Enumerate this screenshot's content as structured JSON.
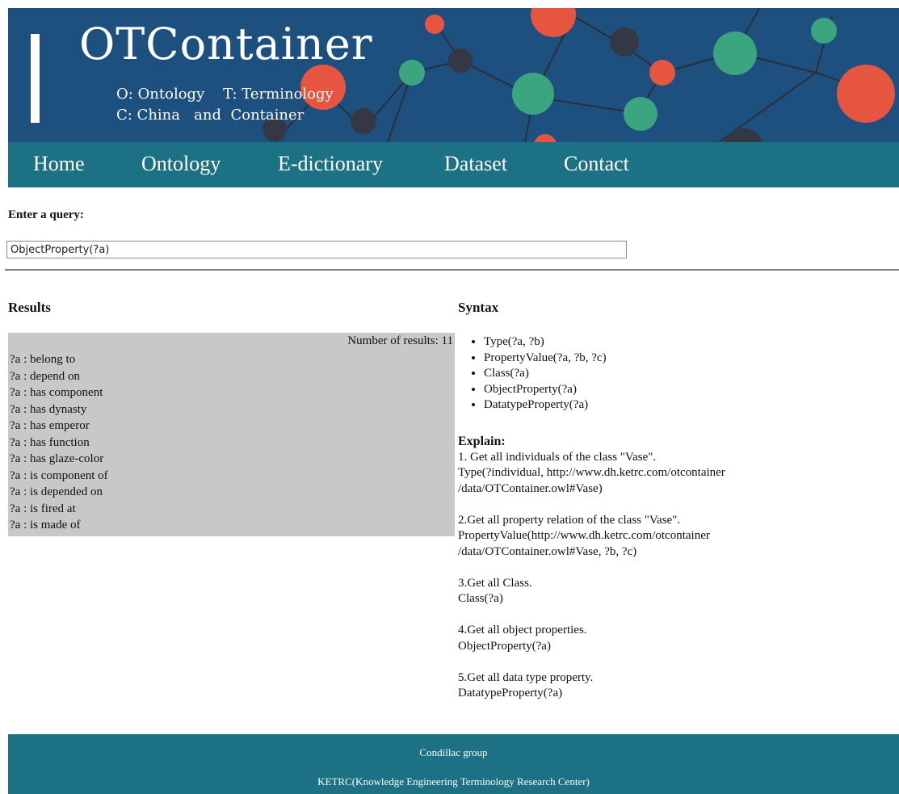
{
  "header": {
    "brand": "OTContainer",
    "tagline_1": "O: Ontology    T: Terminology",
    "tagline_2": "C: China   and  Container"
  },
  "nav": {
    "items": [
      {
        "label": "Home"
      },
      {
        "label": "Ontology"
      },
      {
        "label": "E-dictionary"
      },
      {
        "label": "Dataset"
      },
      {
        "label": "Contact"
      }
    ]
  },
  "query": {
    "label": "Enter a query:",
    "value": "ObjectProperty(?a)"
  },
  "results": {
    "title": "Results",
    "count_label": "Number of results:",
    "count": "11",
    "items": [
      "?a : belong to",
      "?a : depend on",
      "?a : has component",
      "?a : has dynasty",
      "?a : has emperor",
      "?a : has function",
      "?a : has glaze-color",
      "?a : is component of",
      "?a : is depended on",
      "?a : is fired at",
      "?a : is made of"
    ]
  },
  "syntax": {
    "title": "Syntax",
    "items": [
      "Type(?a, ?b)",
      "PropertyValue(?a, ?b, ?c)",
      "Class(?a)",
      "ObjectProperty(?a)",
      "DatatypeProperty(?a)"
    ]
  },
  "explain": {
    "title": "Explain:",
    "blocks": [
      {
        "lines": [
          "1. Get all individuals of the class \"Vase\".",
          "Type(?individual, http://www.dh.ketrc.com/otcontainer",
          "/data/OTContainer.owl#Vase)"
        ]
      },
      {
        "lines": [
          "2.Get all property relation of the class \"Vase\".",
          "PropertyValue(http://www.dh.ketrc.com/otcontainer",
          "/data/OTContainer.owl#Vase, ?b, ?c)"
        ]
      },
      {
        "lines": [
          "3.Get all Class.",
          "Class(?a)"
        ]
      },
      {
        "lines": [
          "4.Get all object properties.",
          "ObjectProperty(?a)"
        ]
      },
      {
        "lines": [
          "5.Get all data type property.",
          "DatatypeProperty(?a)"
        ]
      }
    ]
  },
  "footer": {
    "line_1": "Condillac group",
    "line_2": "KETRC(Knowledge Engineering Terminology Research Center)"
  },
  "colors": {
    "banner_bg": "#1d507e",
    "nav_bg": "#1d7184",
    "footer_bg": "#1d7184",
    "results_bg": "#c8c8c8",
    "node_red": "#e5553f",
    "node_green": "#3aa57e",
    "node_dark": "#333844"
  }
}
